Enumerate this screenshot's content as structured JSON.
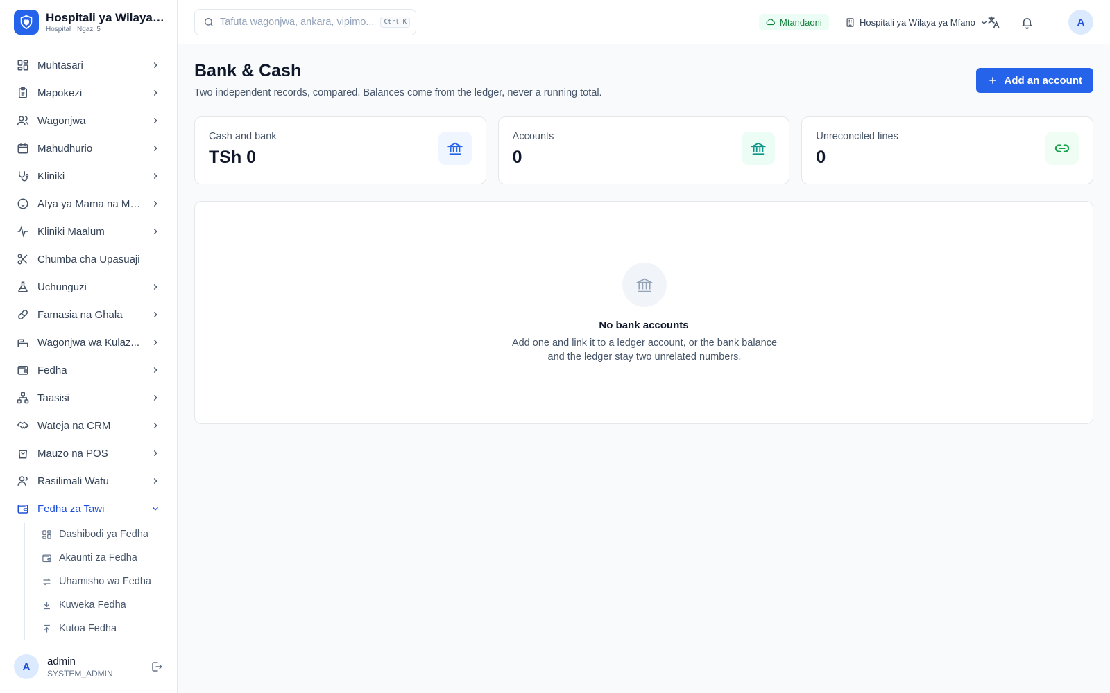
{
  "brand": {
    "name": "Hospitali ya Wilaya ...",
    "subtitle": "Hospital · Ngazi 5",
    "logo_icon": "heart-shield-icon"
  },
  "sidebar": {
    "items": [
      {
        "label": "Muhtasari",
        "icon": "dashboard-grid-icon",
        "chevron": true
      },
      {
        "label": "Mapokezi",
        "icon": "clipboard-icon",
        "chevron": true
      },
      {
        "label": "Wagonjwa",
        "icon": "users-icon",
        "chevron": true
      },
      {
        "label": "Mahudhurio",
        "icon": "calendar-icon",
        "chevron": true
      },
      {
        "label": "Kliniki",
        "icon": "stethoscope-icon",
        "chevron": true
      },
      {
        "label": "Afya ya Mama na Mt...",
        "icon": "baby-icon",
        "chevron": true
      },
      {
        "label": "Kliniki Maalum",
        "icon": "activity-icon",
        "chevron": true
      },
      {
        "label": "Chumba cha Upasuaji",
        "icon": "scissors-icon",
        "chevron": false
      },
      {
        "label": "Uchunguzi",
        "icon": "flask-icon",
        "chevron": true
      },
      {
        "label": "Famasia na Ghala",
        "icon": "pill-icon",
        "chevron": true
      },
      {
        "label": "Wagonjwa wa Kulaz...",
        "icon": "bed-icon",
        "chevron": true
      },
      {
        "label": "Fedha",
        "icon": "wallet-icon",
        "chevron": true
      },
      {
        "label": "Taasisi",
        "icon": "org-chart-icon",
        "chevron": true
      },
      {
        "label": "Wateja na CRM",
        "icon": "handshake-icon",
        "chevron": true
      },
      {
        "label": "Mauzo na POS",
        "icon": "shopping-bag-icon",
        "chevron": true
      },
      {
        "label": "Rasilimali Watu",
        "icon": "people-icon",
        "chevron": true
      },
      {
        "label": "Fedha za Tawi",
        "icon": "wallet-icon",
        "chevron": true,
        "active": true
      }
    ],
    "subitems": [
      {
        "label": "Dashibodi ya Fedha",
        "icon": "dashboard-grid-icon"
      },
      {
        "label": "Akaunti za Fedha",
        "icon": "wallet-icon"
      },
      {
        "label": "Uhamisho wa Fedha",
        "icon": "transfer-arrows-icon"
      },
      {
        "label": "Kuweka Fedha",
        "icon": "download-icon"
      },
      {
        "label": "Kutoa Fedha",
        "icon": "upload-icon"
      }
    ]
  },
  "user": {
    "initial": "A",
    "name": "admin",
    "role": "SYSTEM_ADMIN"
  },
  "topbar": {
    "search_placeholder": "Tafuta wagonjwa, ankara, vipimo...",
    "search_shortcut": "Ctrl K",
    "status": "Mtandaoni",
    "facility": "Hospitali ya Wilaya ya Mfano",
    "avatar_initial": "A"
  },
  "page": {
    "title": "Bank & Cash",
    "subtitle": "Two independent records, compared. Balances come from the ledger, never a running total.",
    "add_button": "Add an account"
  },
  "stats": [
    {
      "label": "Cash and bank",
      "value": "TSh 0",
      "icon": "bank-icon",
      "color": "#2563eb",
      "bg": "#eff6ff"
    },
    {
      "label": "Accounts",
      "value": "0",
      "icon": "bank-icon",
      "color": "#0d9488",
      "bg": "#ecfdf5"
    },
    {
      "label": "Unreconciled lines",
      "value": "0",
      "icon": "link-icon",
      "color": "#16a34a",
      "bg": "#f0fdf4"
    }
  ],
  "empty_state": {
    "title": "No bank accounts",
    "description": "Add one and link it to a ledger account, or the bank balance and the ledger stay two unrelated numbers.",
    "icon": "bank-icon"
  },
  "colors": {
    "accent": "#2563eb",
    "online": "#15803d"
  }
}
